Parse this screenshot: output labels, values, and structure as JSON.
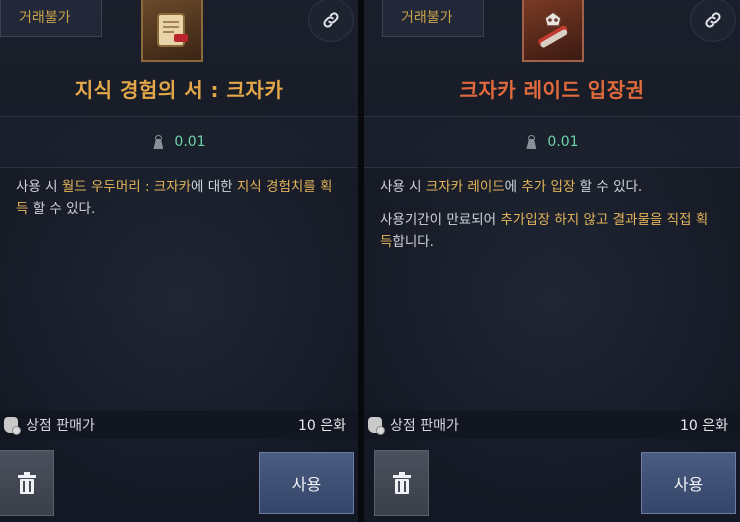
{
  "panels": [
    {
      "trade_badge": "거래불가",
      "icon": "scroll-icon",
      "title": "지식 경험의 서 : 크자카",
      "weight": "0.01",
      "description": [
        [
          {
            "text": "사용 시 ",
            "hl": false
          },
          {
            "text": "월드 우두머리 : 크자카",
            "hl": true
          },
          {
            "text": "에 대한 ",
            "hl": false
          },
          {
            "text": "지식 경험치를 획득",
            "hl": true
          },
          {
            "text": " 할 수 있다.",
            "hl": false
          }
        ]
      ],
      "sell_label": "상점 판매가",
      "sell_price": "10 은화",
      "use_label": "사용"
    },
    {
      "trade_badge": "거래불가",
      "icon": "raid-ticket-icon",
      "title": "크자카 레이드 입장권",
      "weight": "0.01",
      "description": [
        [
          {
            "text": "사용 시 ",
            "hl": false
          },
          {
            "text": "크자카 레이드",
            "hl": true
          },
          {
            "text": "에 ",
            "hl": false
          },
          {
            "text": "추가 입장",
            "hl": true
          },
          {
            "text": " 할 수 있다.",
            "hl": false
          }
        ],
        [
          {
            "text": "사용기간이 만료되어 ",
            "hl": false
          },
          {
            "text": "추가입장 하지 않고 결과물을 직접 획득",
            "hl": true
          },
          {
            "text": "합니다.",
            "hl": false
          }
        ]
      ],
      "sell_label": "상점 판매가",
      "sell_price": "10 은화",
      "use_label": "사용"
    }
  ],
  "colors": {
    "left_title": "#e4a84a",
    "right_title": "#e06a3c",
    "highlight": "#e4b55a",
    "weight": "#6fd3a9"
  }
}
